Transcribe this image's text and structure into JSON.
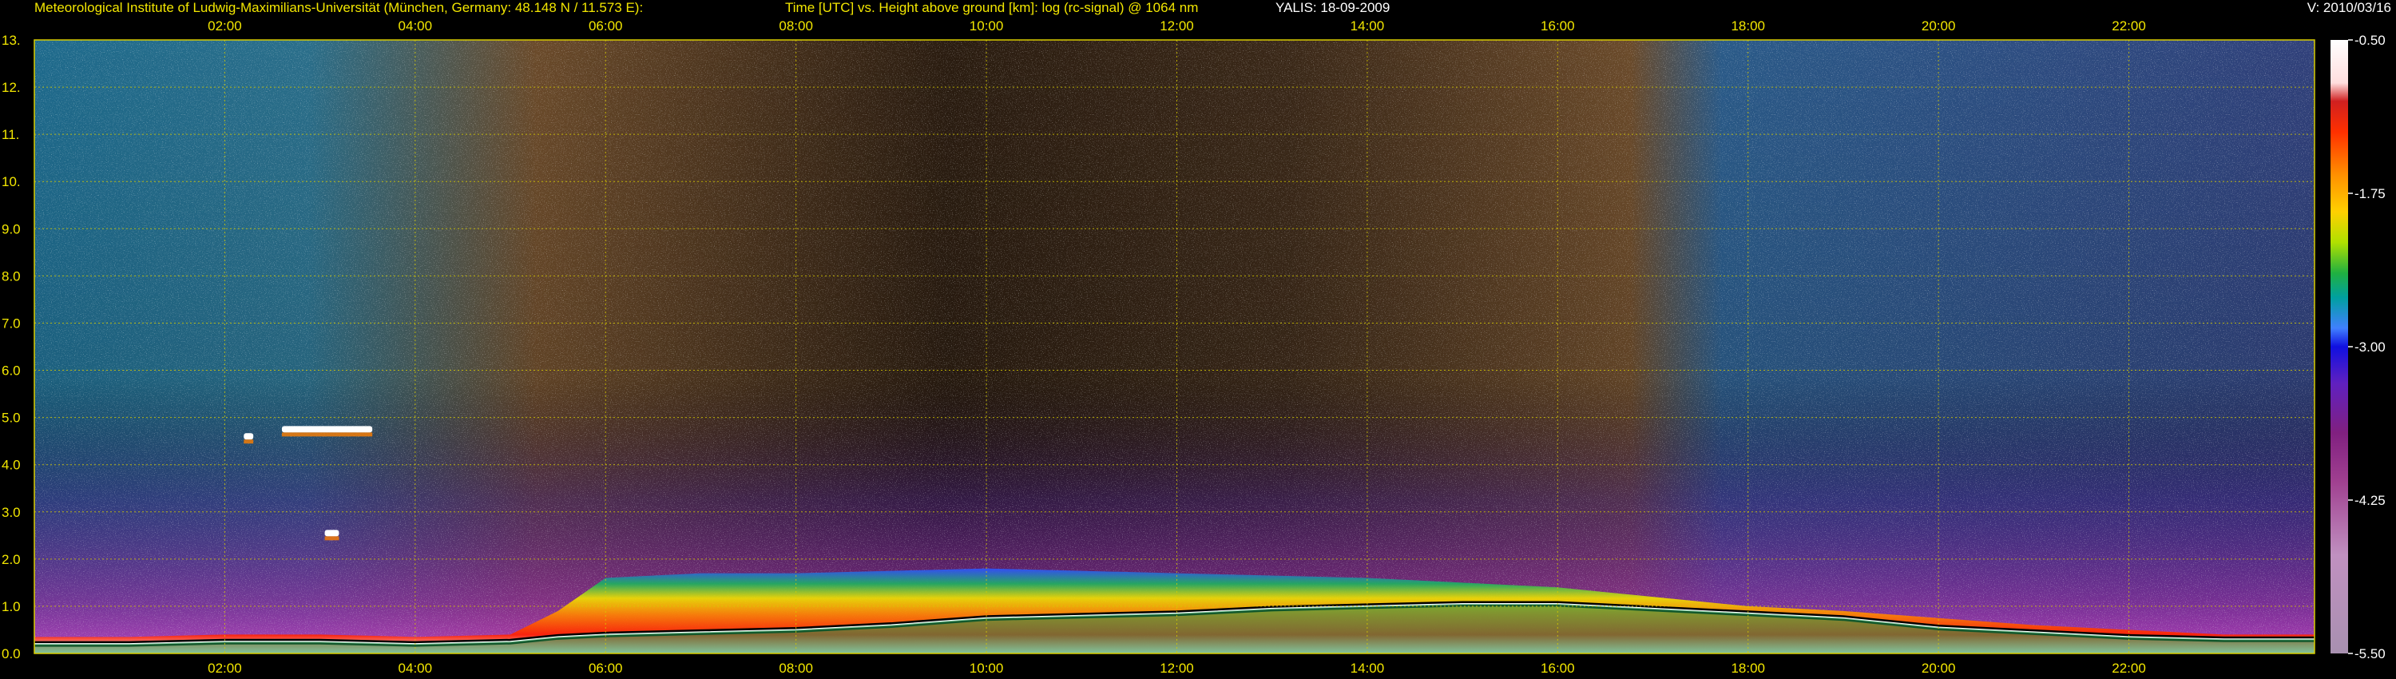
{
  "header": {
    "institute": "Meteorological Institute of Ludwig-Maximilians-Universität (München, Germany: 48.148 N / 11.573 E):",
    "title": "Time [UTC] vs. Height above ground [km]: log (rc-signal) @ 1064 nm",
    "instrument": "YALIS: 18-09-2009",
    "version": "V: 2010/03/16"
  },
  "chart_data": {
    "type": "heatmap",
    "title": "Time [UTC] vs. Height above ground [km]: log (rc-signal) @ 1064 nm",
    "xlabel": "",
    "ylabel": "",
    "x_range_hours": [
      0.0,
      23.95
    ],
    "x_ticks": [
      "02:00",
      "04:00",
      "06:00",
      "08:00",
      "10:00",
      "12:00",
      "14:00",
      "16:00",
      "18:00",
      "20:00",
      "22:00"
    ],
    "x_tick_hours": [
      2,
      4,
      6,
      8,
      10,
      12,
      14,
      16,
      18,
      20,
      22
    ],
    "top_x_ticks": [
      "02:00",
      "04:00",
      "06:00",
      "08:00",
      "10:00",
      "12:00",
      "14:00",
      "16:00",
      "18:00",
      "20:00",
      "22:00"
    ],
    "y_ticks": [
      "0.0",
      "1.0",
      "2.0",
      "3.0",
      "4.0",
      "5.0",
      "6.0",
      "7.0",
      "8.0",
      "9.0",
      "10.",
      "11.",
      "12.",
      "13."
    ],
    "y_tick_values": [
      0,
      1,
      2,
      3,
      4,
      5,
      6,
      7,
      8,
      9,
      10,
      11,
      12,
      13
    ],
    "ylim": [
      0,
      13
    ],
    "grid": true,
    "colorbar": {
      "range": [
        -5.5,
        -0.5
      ],
      "ticks": [
        "-0.50",
        "-1.75",
        "-3.00",
        "-4.25",
        "-5.50"
      ],
      "tick_values": [
        -0.5,
        -1.75,
        -3.0,
        -4.25,
        -5.5
      ],
      "stops": [
        {
          "v": -0.5,
          "color": "#ffffff"
        },
        {
          "v": -0.85,
          "color": "#ffdede"
        },
        {
          "v": -1.0,
          "color": "#d02020"
        },
        {
          "v": -1.25,
          "color": "#ff3000"
        },
        {
          "v": -1.6,
          "color": "#ff9000"
        },
        {
          "v": -1.9,
          "color": "#ffd000"
        },
        {
          "v": -2.15,
          "color": "#b0e000"
        },
        {
          "v": -2.4,
          "color": "#20b040"
        },
        {
          "v": -2.6,
          "color": "#00a0a0"
        },
        {
          "v": -2.85,
          "color": "#4080ff"
        },
        {
          "v": -3.0,
          "color": "#1010e0"
        },
        {
          "v": -3.3,
          "color": "#6020c0"
        },
        {
          "v": -3.7,
          "color": "#802080"
        },
        {
          "v": -4.1,
          "color": "#a04090"
        },
        {
          "v": -4.7,
          "color": "#c090c0"
        },
        {
          "v": -5.5,
          "color": "#a890b0"
        }
      ]
    },
    "boundary_layer": {
      "hours": [
        0.0,
        1.0,
        2.0,
        3.0,
        4.0,
        5.0,
        5.5,
        6.0,
        7.0,
        8.0,
        9.0,
        10.0,
        11.0,
        12.0,
        13.0,
        14.0,
        15.0,
        16.0,
        16.5,
        17.0,
        18.0,
        19.0,
        20.0,
        21.0,
        22.0,
        23.0,
        23.95
      ],
      "top_km": [
        0.35,
        0.35,
        0.4,
        0.4,
        0.35,
        0.4,
        0.9,
        1.6,
        1.7,
        1.7,
        1.75,
        1.8,
        1.75,
        1.7,
        1.65,
        1.6,
        1.5,
        1.4,
        1.3,
        1.2,
        1.0,
        0.9,
        0.75,
        0.6,
        0.5,
        0.4,
        0.4
      ],
      "aerosol_km": [
        0.2,
        0.2,
        0.25,
        0.25,
        0.2,
        0.25,
        0.35,
        0.4,
        0.45,
        0.5,
        0.6,
        0.75,
        0.8,
        0.85,
        0.95,
        1.0,
        1.05,
        1.05,
        1.0,
        0.95,
        0.85,
        0.75,
        0.55,
        0.45,
        0.35,
        0.3,
        0.3
      ]
    },
    "features": [
      {
        "name": "cloud-layer",
        "hours": [
          2.6,
          3.55
        ],
        "km": 4.75
      },
      {
        "name": "cloud-layer",
        "hours": [
          2.2,
          2.3
        ],
        "km": 4.6
      },
      {
        "name": "cloud-patch",
        "hours": [
          3.05,
          3.2
        ],
        "km": 2.55
      }
    ]
  }
}
